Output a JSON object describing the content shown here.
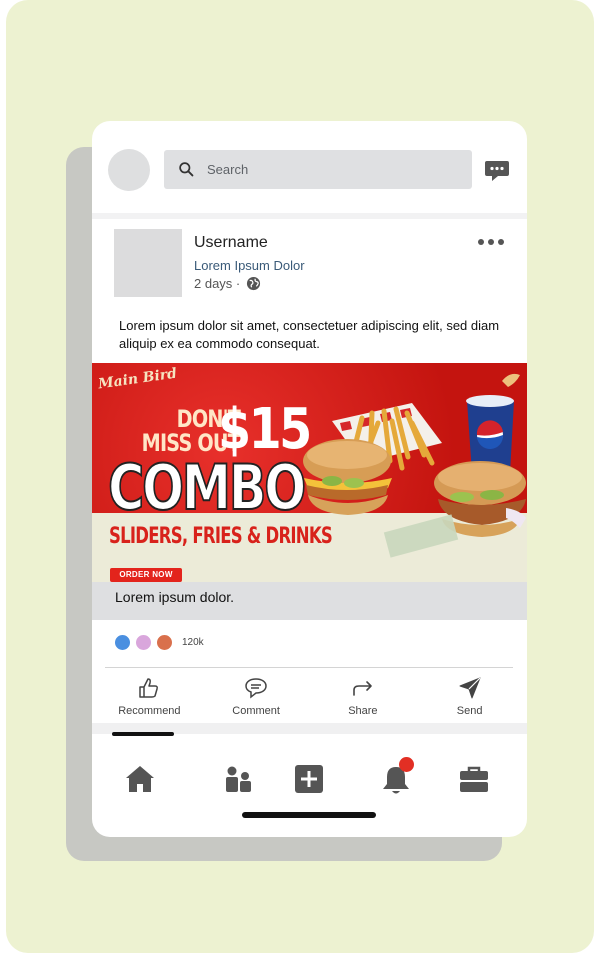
{
  "search": {
    "placeholder": "Search"
  },
  "post": {
    "username": "Username",
    "subtitle": "Lorem Ipsum Dolor",
    "time": "2 days ·",
    "text": "Lorem ipsum dolor sit amet, consectetuer adipiscing elit, sed diam aliquip ex ea commodo consequat.",
    "caption": "Lorem ipsum dolor."
  },
  "banner": {
    "logo": "Main Bird",
    "line1": "DON'T",
    "line2": "MISS OUT",
    "price": "$15",
    "headline": "COMBO",
    "sub": "SLIDERS, FRIES & DRINKS",
    "cta": "ORDER NOW"
  },
  "reactions": {
    "count": "120k",
    "colors": [
      "#4a8fe0",
      "#d9a6dc",
      "#d9704c"
    ]
  },
  "actions": [
    {
      "label": "Recommend",
      "icon": "thumbs-up-icon"
    },
    {
      "label": "Comment",
      "icon": "comment-icon"
    },
    {
      "label": "Share",
      "icon": "share-arrow-icon"
    },
    {
      "label": "Send",
      "icon": "send-icon"
    }
  ],
  "nav": [
    {
      "icon": "home-icon"
    },
    {
      "icon": "people-icon"
    },
    {
      "icon": "add-icon"
    },
    {
      "icon": "bell-icon"
    },
    {
      "icon": "briefcase-icon"
    }
  ],
  "colors": {
    "background": "#edf2d1",
    "accent": "#d41a17",
    "badge": "#e22f24"
  }
}
